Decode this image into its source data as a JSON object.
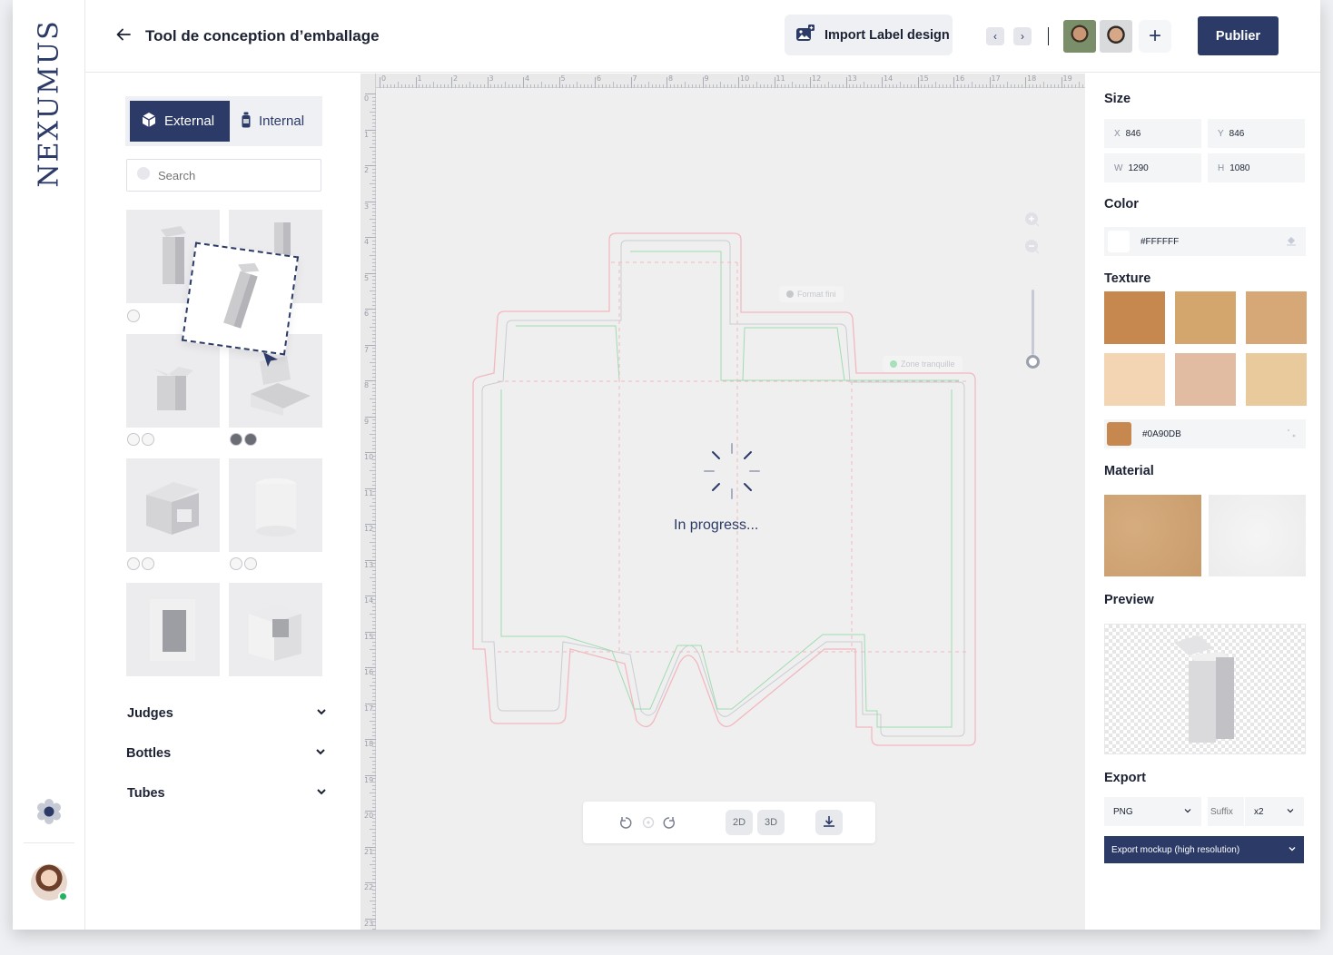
{
  "brand": {
    "logo_text": "NEXUMUS"
  },
  "header": {
    "title": "Tool de conception d’emballage",
    "import_label": "Import Label design",
    "prev_icon": "‹",
    "next_icon": "›",
    "add_icon": "+",
    "publish_label": "Publier"
  },
  "left_panel": {
    "tabs": [
      {
        "label": "External",
        "active": true
      },
      {
        "label": "Internal",
        "active": false
      }
    ],
    "search_placeholder": "Search",
    "categories": [
      {
        "label": "Judges"
      },
      {
        "label": "Bottles"
      },
      {
        "label": "Tubes"
      }
    ]
  },
  "canvas": {
    "status_text": "In progress...",
    "tag_format": "Format fini",
    "tag_zone": "Zone tranquille",
    "ruler_top": [
      "0",
      "1",
      "2",
      "3",
      "4",
      "5",
      "6",
      "7",
      "8",
      "9",
      "10",
      "11",
      "12",
      "13",
      "14",
      "15",
      "16",
      "17",
      "18",
      "19"
    ],
    "ruler_left": [
      "0",
      "1",
      "2",
      "3",
      "4",
      "5",
      "6",
      "7",
      "8",
      "9",
      "10",
      "11",
      "12",
      "13",
      "14",
      "15",
      "16",
      "17",
      "18",
      "19",
      "20",
      "21",
      "22",
      "23"
    ],
    "view_2d": "2D",
    "view_3d": "3D"
  },
  "right_panel": {
    "size_label": "Size",
    "size": {
      "x_key": "X",
      "x": "846",
      "y_key": "Y",
      "y": "846",
      "w_key": "W",
      "w": "1290",
      "h_key": "H",
      "h": "1080"
    },
    "color_label": "Color",
    "color_value": "#FFFFFF",
    "texture_label": "Texture",
    "texture_colors": [
      "#c7884f",
      "#d2a66d",
      "#d6a878",
      "#f3d5b3",
      "#e2bca2",
      "#e8ca9c"
    ],
    "texture_value": "#0A90DB",
    "texture_chip_color": "#c7884f",
    "material_label": "Material",
    "preview_label": "Preview",
    "export_label": "Export",
    "export_format": "PNG",
    "export_suffix_placeholder": "Suffix",
    "export_scale": "x2",
    "export_button": "Export mockup (high resolution)"
  },
  "colors": {
    "primary": "#2b3a67",
    "online": "#22b35e",
    "dieline_outer": "#f2b8c0",
    "dieline_inner": "#9fdcb1"
  }
}
